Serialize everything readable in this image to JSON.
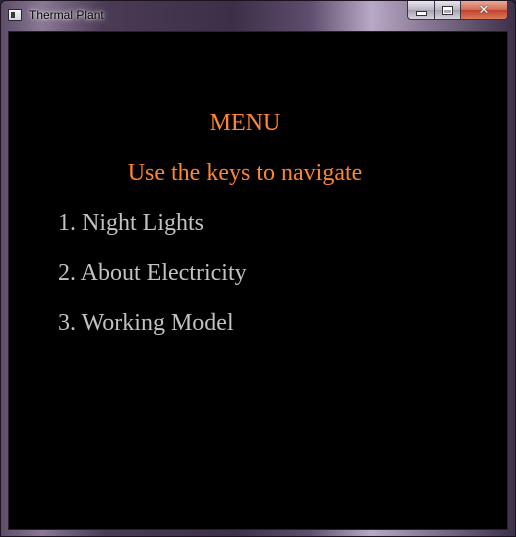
{
  "window": {
    "title": "Thermal Plant",
    "icon": "application-window-icon",
    "buttons": {
      "minimize_icon": "minimize-icon",
      "maximize_icon": "maximize-icon",
      "close_icon": "close-icon",
      "close_glyph": "✕"
    }
  },
  "menu": {
    "title": "MENU",
    "subtitle": "Use the keys to navigate",
    "items": [
      {
        "label": "1. Night Lights"
      },
      {
        "label": "2. About Electricity"
      },
      {
        "label": "3. Working Model"
      }
    ]
  },
  "colors": {
    "background": "#000000",
    "heading": "#ff8533",
    "item_text": "#c2c2c2",
    "close_button": "#c0432a"
  }
}
